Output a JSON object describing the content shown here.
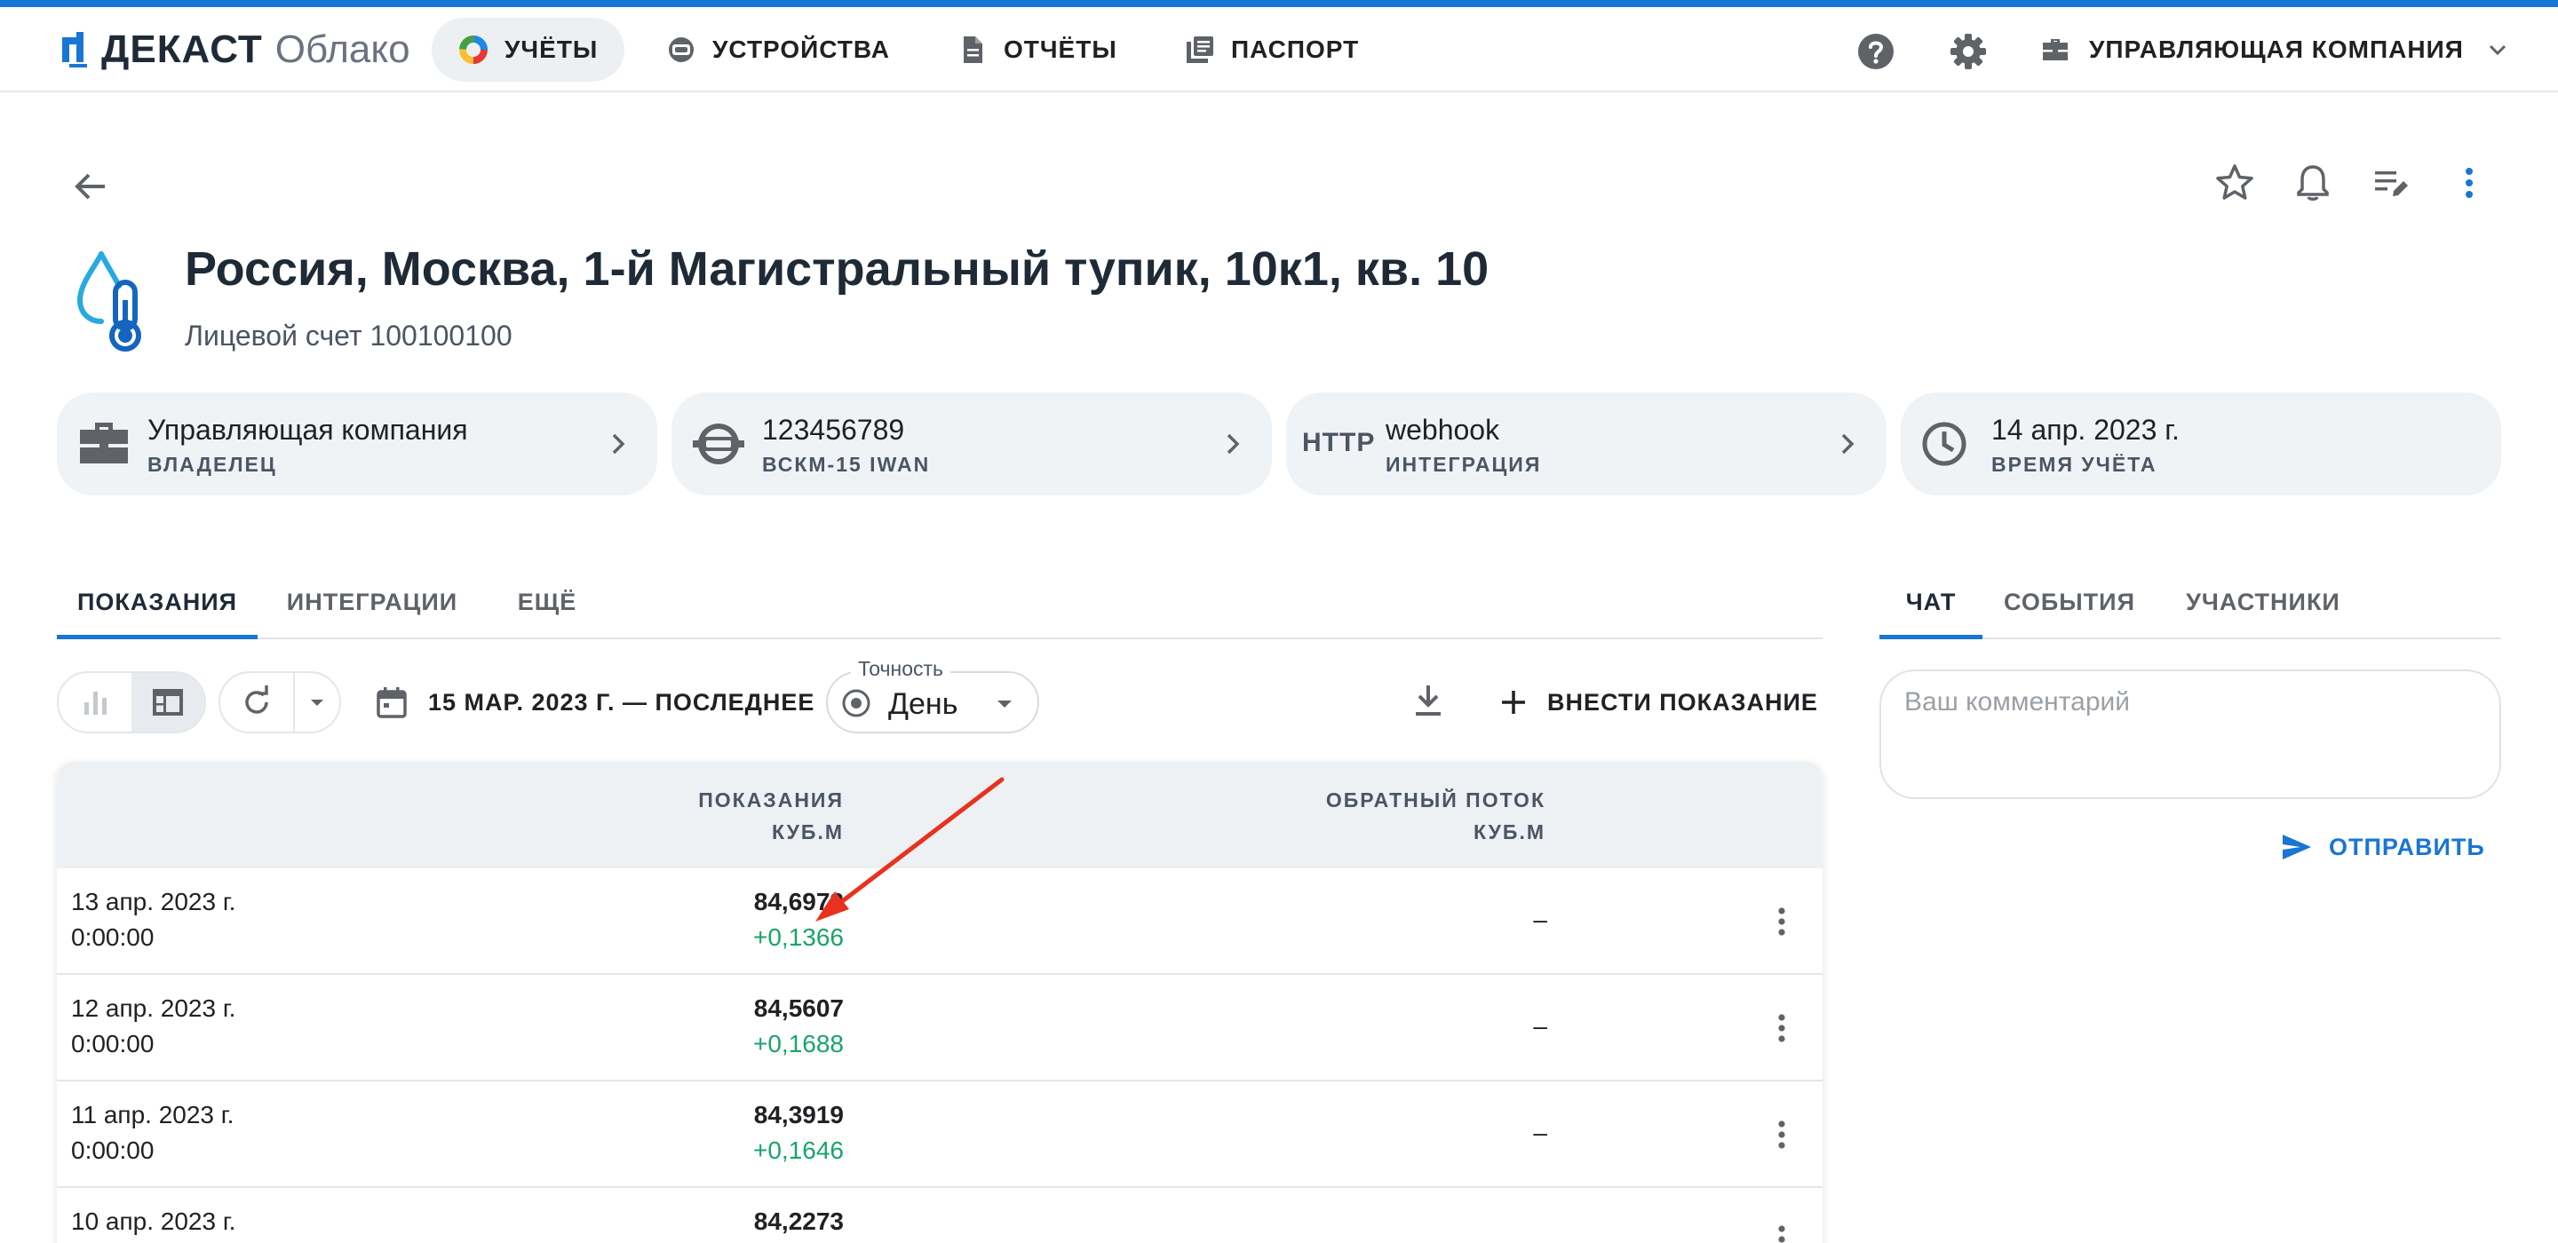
{
  "colors": {
    "accent": "#1976d2",
    "positive": "#1aa36a",
    "text": "#202124",
    "muted": "#4b5563",
    "card_bg": "#f0f3f6"
  },
  "header": {
    "logo_brand": "ДЕКАСТ",
    "logo_product": "Облако",
    "nav": [
      {
        "label": "УЧЁТЫ",
        "icon": "pie-chart-icon",
        "active": true
      },
      {
        "label": "УСТРОЙСТВА",
        "icon": "meter-icon",
        "active": false
      },
      {
        "label": "ОТЧЁТЫ",
        "icon": "document-icon",
        "active": false
      },
      {
        "label": "ПАСПОРТ",
        "icon": "library-icon",
        "active": false
      }
    ],
    "company_menu": "УПРАВЛЯЮЩАЯ КОМПАНИЯ",
    "right_icons": [
      "help-icon",
      "settings-icon",
      "briefcase-icon",
      "chevron-down-icon"
    ]
  },
  "page": {
    "title": "Россия, Москва, 1-й Магистральный тупик, 10к1, кв. 10",
    "subtitle": "Лицевой счет 100100100",
    "actions": [
      "star-icon",
      "bell-icon",
      "edit-list-icon",
      "more-vertical-icon"
    ]
  },
  "cards": [
    {
      "title": "Управляющая компания",
      "subtitle": "ВЛАДЕЛЕЦ",
      "icon": "briefcase-icon"
    },
    {
      "title": "123456789",
      "subtitle": "ВСКМ-15 IWAN",
      "icon": "water-meter-icon"
    },
    {
      "title": "webhook",
      "subtitle": "ИНТЕГРАЦИЯ",
      "icon": "http-icon",
      "icon_text": "HTTP"
    },
    {
      "title": "14 апр. 2023 г.",
      "subtitle": "ВРЕМЯ УЧЁТА",
      "icon": "clock-icon"
    }
  ],
  "main_tabs": [
    {
      "label": "ПОКАЗАНИЯ",
      "active": true
    },
    {
      "label": "ИНТЕГРАЦИИ",
      "active": false
    },
    {
      "label": "ЕЩЁ",
      "active": false
    }
  ],
  "toolbar": {
    "period": "15 МАР. 2023 Г. — ПОСЛЕДНЕЕ",
    "precision_label": "Точность",
    "precision_value": "День",
    "add_reading": "ВНЕСТИ ПОКАЗАНИЕ"
  },
  "table": {
    "columns": [
      {
        "title": "ПОКАЗАНИЯ",
        "unit": "КУБ.М"
      },
      {
        "title": "ОБРАТНЫЙ ПОТОК",
        "unit": "КУБ.М"
      }
    ],
    "rows": [
      {
        "date": "13 апр. 2023 г.",
        "time": "0:00:00",
        "value": "84,6973",
        "delta": "+0,1366",
        "backflow": "–"
      },
      {
        "date": "12 апр. 2023 г.",
        "time": "0:00:00",
        "value": "84,5607",
        "delta": "+0,1688",
        "backflow": "–"
      },
      {
        "date": "11 апр. 2023 г.",
        "time": "0:00:00",
        "value": "84,3919",
        "delta": "+0,1646",
        "backflow": "–"
      },
      {
        "date": "10 апр. 2023 г.",
        "time": "",
        "value": "84,2273",
        "delta": "",
        "backflow": ""
      }
    ]
  },
  "side": {
    "tabs": [
      {
        "label": "ЧАТ",
        "active": true
      },
      {
        "label": "СОБЫТИЯ",
        "active": false
      },
      {
        "label": "УЧАСТНИКИ",
        "active": false
      }
    ],
    "comment_placeholder": "Ваш комментарий",
    "send_label": "ОТПРАВИТЬ"
  }
}
